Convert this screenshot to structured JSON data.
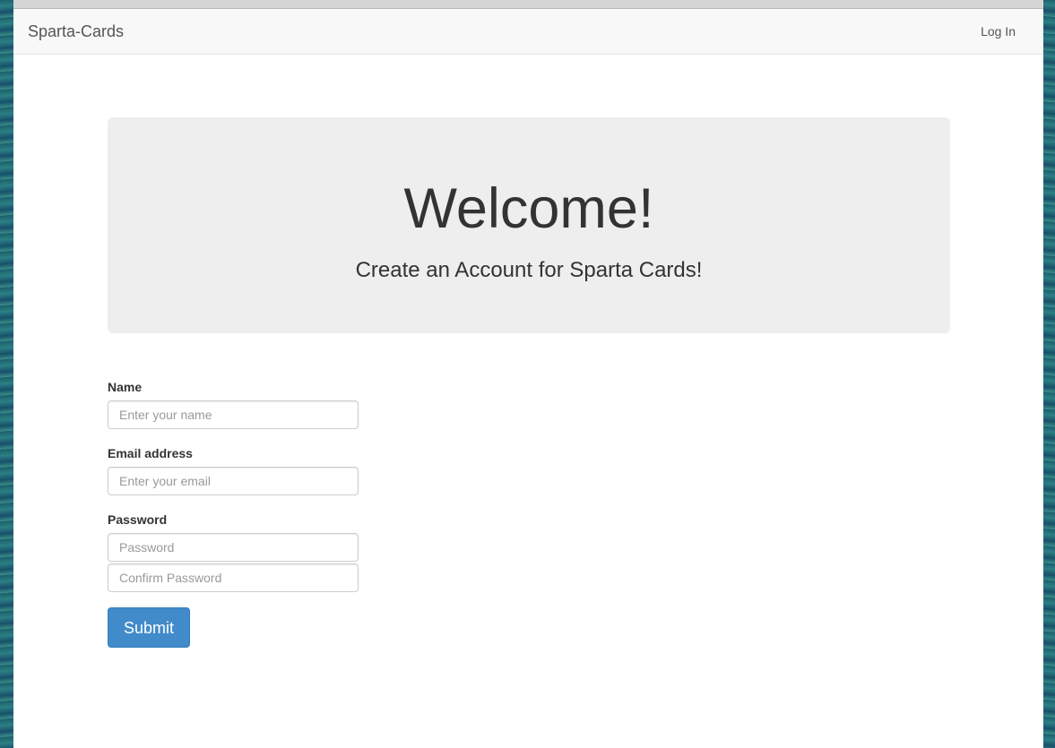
{
  "navbar": {
    "brand": "Sparta-Cards",
    "login_label": "Log In"
  },
  "jumbotron": {
    "title": "Welcome!",
    "subtitle": "Create an Account for Sparta Cards!"
  },
  "form": {
    "name_label": "Name",
    "name_placeholder": "Enter your name",
    "email_label": "Email address",
    "email_placeholder": "Enter your email",
    "password_label": "Password",
    "password_placeholder": "Password",
    "confirm_placeholder": "Confirm Password",
    "submit_label": "Submit"
  },
  "colors": {
    "primary": "#428bca",
    "navbar_bg": "#f8f8f8",
    "jumbotron_bg": "#eeeeee",
    "text": "#333333"
  }
}
